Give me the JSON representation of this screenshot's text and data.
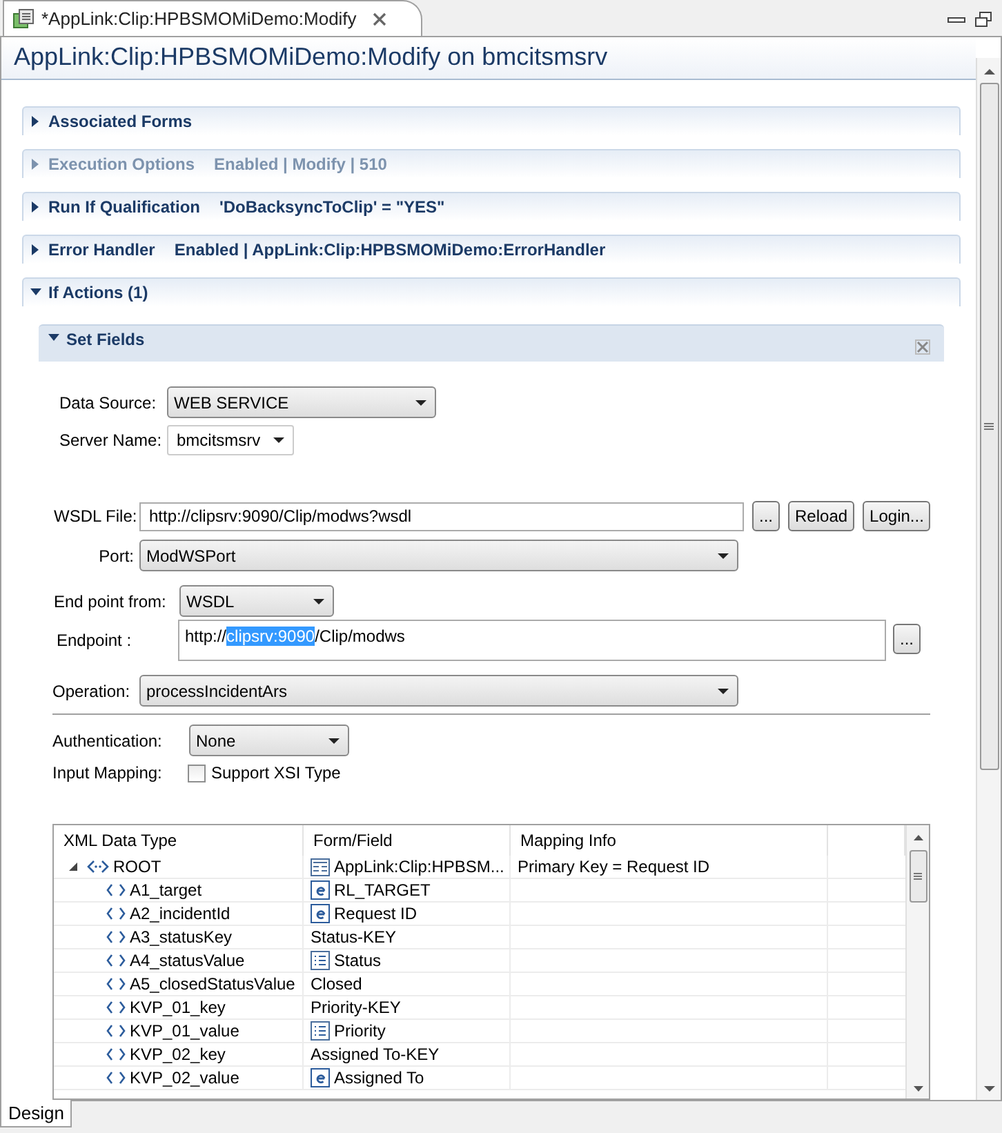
{
  "tab": {
    "title": "*AppLink:Clip:HPBSMOMiDemo:Modify",
    "selected": true
  },
  "header": {
    "title": "AppLink:Clip:HPBSMOMiDemo:Modify on bmcitsmsrv"
  },
  "sections": [
    {
      "label": "Associated Forms",
      "expanded": false,
      "disabled": false
    },
    {
      "label": "Execution Options",
      "summary": "Enabled | Modify | 510",
      "expanded": false,
      "disabled": true
    },
    {
      "label": "Run If Qualification",
      "summary": "'DoBacksyncToClip' = \"YES\"",
      "expanded": false,
      "disabled": false
    },
    {
      "label": "Error Handler",
      "summary": "Enabled | AppLink:Clip:HPBSMOMiDemo:ErrorHandler",
      "expanded": false,
      "disabled": false
    },
    {
      "label": "If Actions (1)",
      "expanded": true,
      "disabled": false
    }
  ],
  "set_fields": {
    "title": "Set Fields",
    "expanded": true
  },
  "form": {
    "data_source": {
      "label": "Data Source:",
      "value": "WEB SERVICE"
    },
    "server_name": {
      "label": "Server Name:",
      "value": "bmcitsmsrv"
    },
    "wsdl_file": {
      "label": "WSDL File:",
      "value": "http://clipsrv:9090/Clip/modws?wsdl",
      "buttons": [
        "...",
        "Reload",
        "Login..."
      ]
    },
    "port": {
      "label": "Port:",
      "value": "ModWSPort"
    },
    "endpoint_from": {
      "label": "End point from:",
      "value": "WSDL"
    },
    "endpoint": {
      "label": "Endpoint :",
      "parts": [
        {
          "text": "http://",
          "selected": false
        },
        {
          "text": "clipsrv:9090",
          "selected": true
        },
        {
          "text": "/Clip/modws",
          "selected": false
        }
      ],
      "button": "..."
    },
    "operation": {
      "label": "Operation:",
      "value": "processIncidentArs"
    },
    "authentication": {
      "label": "Authentication:",
      "value": "None"
    },
    "input_mapping": {
      "label": "Input Mapping:",
      "checkbox": {
        "label": "Support XSI Type",
        "checked": false
      }
    }
  },
  "table": {
    "columns": [
      "XML Data Type",
      "Form/Field",
      "Mapping Info"
    ],
    "rows": [
      {
        "name": "ROOT",
        "kind": "sequence",
        "expanded": true,
        "field": {
          "text": "AppLink:Clip:HPBSM...",
          "kind": "form"
        },
        "mapping": "Primary Key = Request ID",
        "children": [
          {
            "name": "A1_target",
            "kind": "element",
            "field": {
              "text": "RL_TARGET",
              "kind": "field"
            }
          },
          {
            "name": "A2_incidentId",
            "kind": "element",
            "field": {
              "text": "Request ID",
              "kind": "field"
            }
          },
          {
            "name": "A3_statusKey",
            "kind": "element",
            "field": {
              "text": "Status-KEY",
              "kind": "plain"
            }
          },
          {
            "name": "A4_statusValue",
            "kind": "element",
            "field": {
              "text": "Status",
              "kind": "list"
            }
          },
          {
            "name": "A5_closedStatusValue",
            "kind": "element",
            "field": {
              "text": "Closed",
              "kind": "plain"
            }
          },
          {
            "name": "KVP_01_key",
            "kind": "element",
            "field": {
              "text": "Priority-KEY",
              "kind": "plain"
            }
          },
          {
            "name": "KVP_01_value",
            "kind": "element",
            "field": {
              "text": "Priority",
              "kind": "list"
            }
          },
          {
            "name": "KVP_02_key",
            "kind": "element",
            "field": {
              "text": "Assigned To-KEY",
              "kind": "plain"
            }
          },
          {
            "name": "KVP_02_value",
            "kind": "element",
            "field": {
              "text": "Assigned To",
              "kind": "field"
            }
          }
        ]
      }
    ]
  },
  "bottom_tabs": [
    {
      "label": "Design",
      "selected": true
    }
  ]
}
